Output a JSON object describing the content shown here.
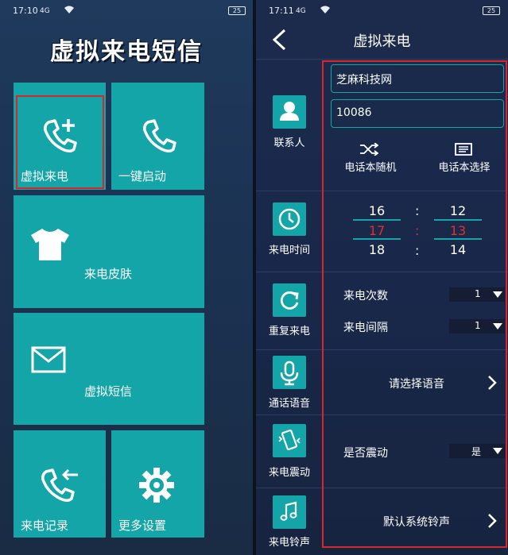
{
  "left_screen": {
    "status": {
      "time": "17:10",
      "signal": "4G",
      "battery": "25"
    },
    "app_title": "虚拟来电短信",
    "tiles": {
      "virtual_call": "虚拟来电",
      "one_key_start": "一键启动",
      "call_skin": "来电皮肤",
      "virtual_sms": "虚拟短信",
      "call_log": "来电记录",
      "more_settings": "更多设置"
    },
    "icons": [
      "phone-add-icon",
      "phone-icon",
      "tshirt-icon",
      "mail-icon",
      "phone-incoming-icon",
      "gear-icon"
    ]
  },
  "right_screen": {
    "status": {
      "time": "17:11",
      "signal": "4G",
      "battery": "25"
    },
    "title": "虚拟来电",
    "contact": {
      "label": "联系人",
      "name_value": "芝麻科技网",
      "number_value": "10086",
      "random_label": "电话本随机",
      "select_label": "电话本选择"
    },
    "call_time": {
      "label": "来电时间",
      "hours": [
        "16",
        "17",
        "18"
      ],
      "minutes": [
        "12",
        "13",
        "14"
      ],
      "selected_color": "#e03030"
    },
    "repeat": {
      "label": "重复来电",
      "count_label": "来电次数",
      "count_value": "1",
      "interval_label": "来电间隔",
      "interval_value": "1"
    },
    "voice": {
      "label": "通话语音",
      "prompt": "请选择语音"
    },
    "vibrate": {
      "label": "来电震动",
      "prompt": "是否震动",
      "value": "是"
    },
    "ringtone": {
      "label": "来电铃声",
      "value": "默认系统铃声"
    }
  },
  "colors": {
    "tile": "#13a5a8",
    "highlight_box": "#d8262b"
  }
}
